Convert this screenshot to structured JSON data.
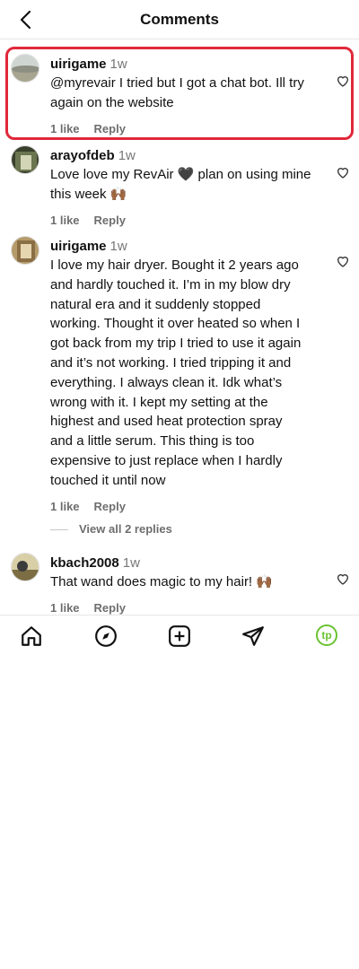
{
  "header": {
    "title": "Comments",
    "back_icon": "chevron-left-icon"
  },
  "comments": [
    {
      "username": "uirigame",
      "time": "1w",
      "text": "@myrevair I tried but I got a chat bot. Ill try again on the website",
      "likes": "1 like",
      "reply": "Reply"
    },
    {
      "username": "arayofdeb",
      "time": "1w",
      "text": "Love love my RevAir 🖤 plan on using mine this week 🙌🏾",
      "likes": "1 like",
      "reply": "Reply"
    },
    {
      "username": "uirigame",
      "time": "1w",
      "text": "I love my hair dryer. Bought it 2 years ago and hardly touched it. I’m in my blow dry natural era and it suddenly stopped working. Thought it over heated so when I got back from my trip I tried to use it again and it’s not working. I tried tripping it and everything. I always clean it. Idk what’s wrong with it. I kept my setting at the highest and used heat protection spray and a little serum. This thing is too expensive to just replace when I hardly touched it until now",
      "likes": "1 like",
      "reply": "Reply"
    },
    {
      "username": "kbach2008",
      "time": "1w",
      "text": "That wand does magic to my hair! 🙌🏾",
      "likes": "1 like",
      "reply": "Reply"
    }
  ],
  "view_replies": "View all 2 replies",
  "tabbar": {
    "icons": [
      "home-icon",
      "explore-icon",
      "create-icon",
      "direct-message-icon",
      "profile-avatar"
    ],
    "profile_initials": "tp",
    "accent": "#6ac232"
  },
  "colors": {
    "highlight": "#e0283a",
    "muted": "#6e6e6e"
  }
}
